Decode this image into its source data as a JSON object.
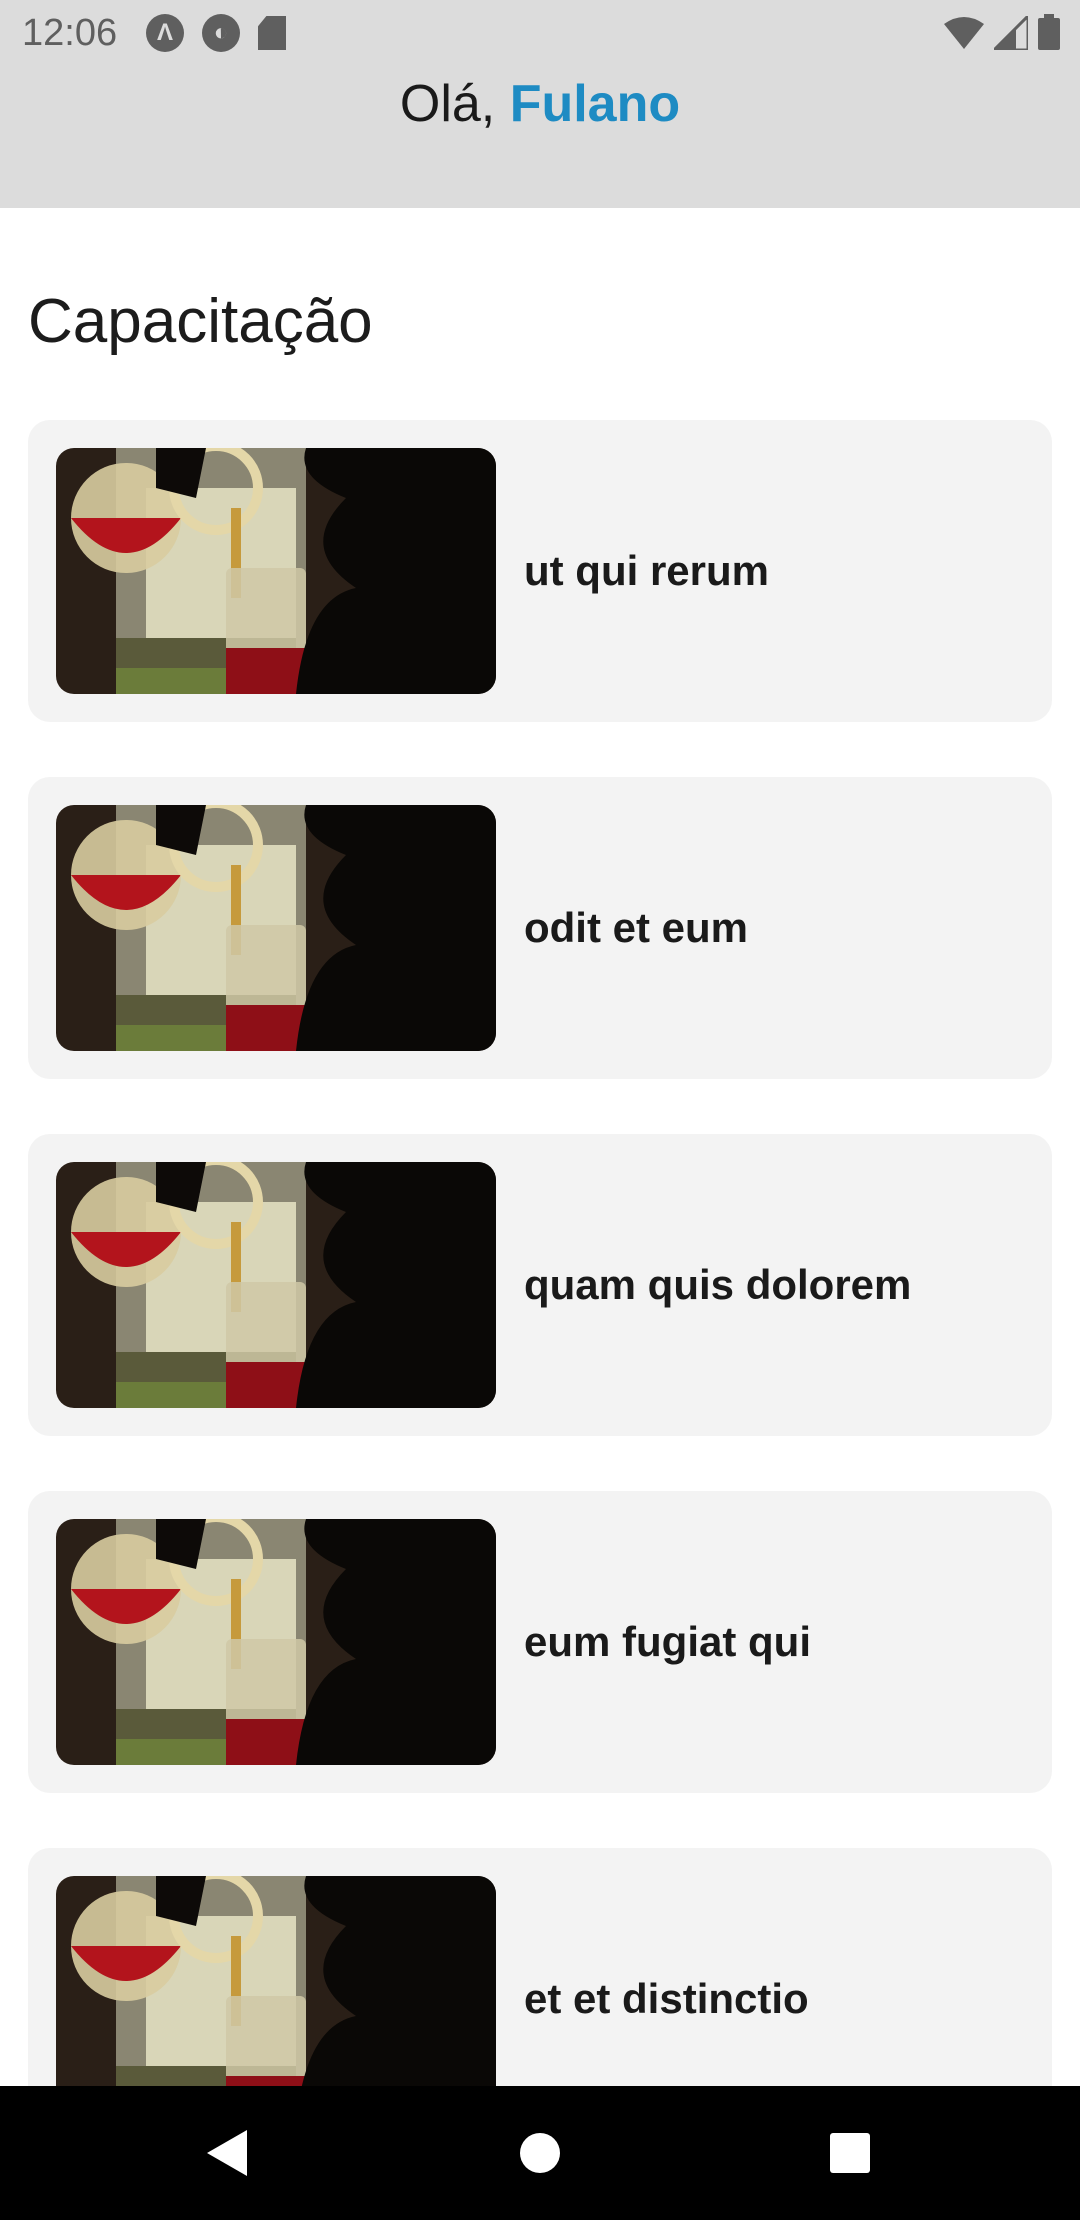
{
  "status_bar": {
    "time": "12:06",
    "left_icons": [
      "app-notification-icon",
      "app-notification-icon-2",
      "sd-card-icon"
    ],
    "right_icons": [
      "wifi-icon",
      "signal-icon",
      "battery-icon"
    ]
  },
  "header": {
    "greeting_prefix": "Olá, ",
    "user_name": "Fulano",
    "accent_color": "#1e8bc3"
  },
  "section": {
    "title": "Capacitação"
  },
  "courses": [
    {
      "title": "ut qui rerum"
    },
    {
      "title": "odit et eum"
    },
    {
      "title": "quam quis dolorem"
    },
    {
      "title": "eum fugiat qui"
    },
    {
      "title": "et et distinctio"
    }
  ],
  "nav_bar": {
    "buttons": [
      "back-icon",
      "home-icon",
      "recents-icon"
    ]
  }
}
